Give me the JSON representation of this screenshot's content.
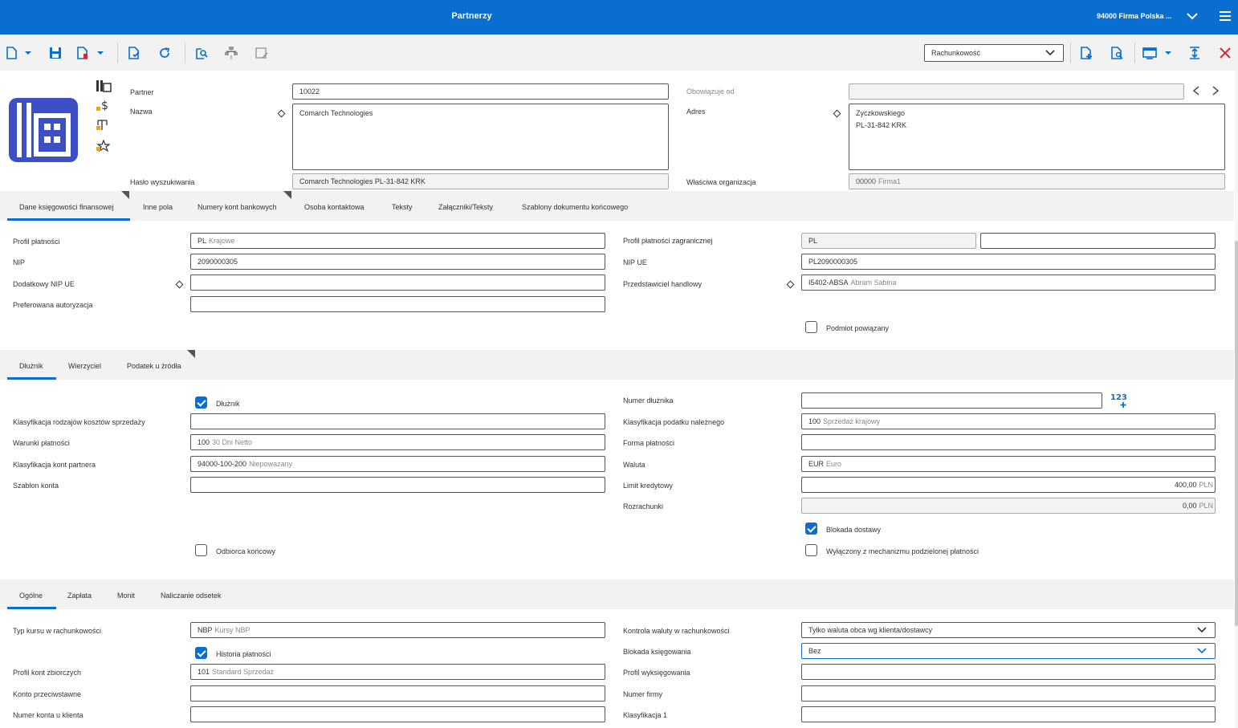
{
  "app": {
    "title": "Partnerzy",
    "company": "94000  Firma Polska ..."
  },
  "toolbar": {
    "view_select": "Rachunkowość"
  },
  "header": {
    "partner_label": "Partner",
    "partner_value": "10022",
    "nazwa_label": "Nazwa",
    "nazwa_value": "Comarch Technologies",
    "haslo_label": "Hasło wyszukiwania",
    "haslo_value": "Comarch Technologies PL-31-842 KRK",
    "obowiazuje_label": "Obowiązuje od",
    "obowiazuje_value": "",
    "adres_label": "Adres",
    "adres_line1": "Zyczkowskiego",
    "adres_line2": "PL-31-842 KRK",
    "wlasciwa_label": "Właściwa organizacja",
    "wlasciwa_code": "00000",
    "wlasciwa_desc": "Firma1"
  },
  "tabs_main": [
    "Dane księgowości finansowej",
    "Inne pola",
    "Numery kont bankowych",
    "Osoba kontaktowa",
    "Teksty",
    "Załączniki/Teksty",
    "Szablony dokumentu końcowego"
  ],
  "finance": {
    "profil_label": "Profil płatności",
    "profil_code": "PL",
    "profil_desc": "Krajowe",
    "nip_label": "NIP",
    "nip_value": "2090000305",
    "dodatkowy_label": "Dodatkowy NIP UE",
    "dodatkowy_value": "",
    "preferowana_label": "Preferowana autoryzacja",
    "preferowana_value": "",
    "profil_zagr_label": "Profil płatności zagranicznej",
    "profil_zagr_value": "PL",
    "profil_zagr_value2": "",
    "nip_ue_label": "NIP UE",
    "nip_ue_value": "PL2090000305",
    "przedst_label": "Przedstawiciel handlowy",
    "przedst_code": "I5402-ABSA",
    "przedst_desc": "Abram Sabina",
    "podmiot_label": "Podmiot powiązany"
  },
  "tabs_second": [
    "Dłużnik",
    "Wierzyciel",
    "Podatek u źródła"
  ],
  "debtor": {
    "dluznik_label": "Dłużnik",
    "klasyf_koszt_label": "Klasyfikacja rodzajów kosztów sprzedaży",
    "klasyf_koszt_value": "",
    "warunki_label": "Warunki płatności",
    "warunki_code": "100",
    "warunki_desc": "30 Dni Netto",
    "klasyf_kont_label": "Klasyfikacja kont partnera",
    "klasyf_kont_code": "94000-100-200",
    "klasyf_kont_desc": "Niepowazany",
    "szablon_label": "Szablon konta",
    "szablon_value": "",
    "odbiorca_label": "Odbiorca końcowy",
    "numer_dluznika_label": "Numer dłużnika",
    "numer_dluznika_value": "",
    "klasyf_podatku_label": "Klasyfikacja podatku należnego",
    "klasyf_podatku_code": "100",
    "klasyf_podatku_desc": "Sprzedaż krajowy",
    "forma_label": "Forma płatności",
    "forma_value": "",
    "waluta_label": "Waluta",
    "waluta_code": "EUR",
    "waluta_desc": "Euro",
    "limit_label": "Limit kredytowy",
    "limit_value": "400,00",
    "limit_currency": "PLN",
    "rozrachunki_label": "Rozrachunki",
    "rozrachunki_value": "0,00",
    "rozrachunki_currency": "PLN",
    "blokada_dostawy_label": "Blokada dostawy",
    "wylaczony_label": "Wyłączony z mechanizmu podzielonej płatności"
  },
  "tabs_third": [
    "Ogólne",
    "Zapłata",
    "Monit",
    "Naliczanie odsetek"
  ],
  "general": {
    "typ_kursu_label": "Typ kursu w rachunkowości",
    "typ_kursu_code": "NBP",
    "typ_kursu_desc": "Kursy NBP",
    "historia_label": "Historia płatności",
    "profil_kont_label": "Profil kont zbiorczych",
    "profil_kont_code": "101",
    "profil_kont_desc": "Standard Sprzedaż",
    "konto_przeciw_label": "Konto przeciwstawne",
    "konto_przeciw_value": "",
    "numer_konta_label": "Numer konta u klienta",
    "numer_konta_value": "",
    "kontrola_label": "Kontrola waluty w rachunkowości",
    "kontrola_value": "Tylko waluta obca wg klienta/dostawcy",
    "blokada_ksieg_label": "Blokada księgowania",
    "blokada_ksieg_value": "Bez",
    "profil_wyks_label": "Profil wyksięgowania",
    "profil_wyks_value": "",
    "numer_firmy_label": "Numer firmy",
    "numer_firmy_value": "",
    "klasyf1_label": "Klasyfikacja 1",
    "klasyf1_value": ""
  }
}
